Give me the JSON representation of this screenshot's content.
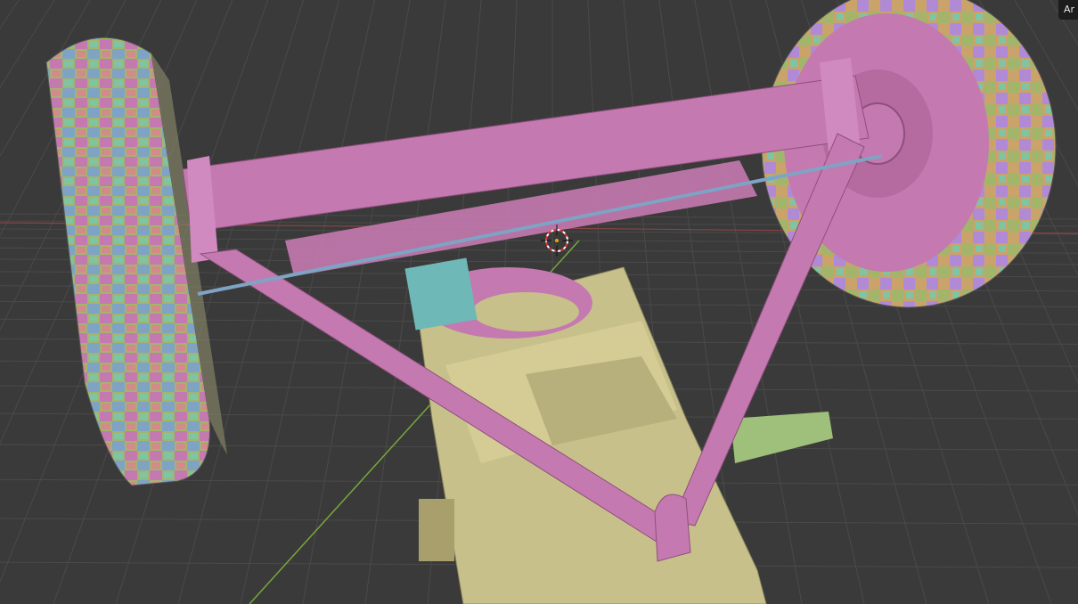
{
  "viewport": {
    "overlay_label": "Ar",
    "background_color": "#3a3a3a",
    "grid_color": "#4a4a4a",
    "y_axis_color": "#7aa63a",
    "x_axis_color": "#8a4444"
  },
  "model": {
    "face_set_colors": [
      "#c47ab0",
      "#a3b56a",
      "#7fa3c4",
      "#c9a36a",
      "#b18ad6",
      "#7fc4a3",
      "#d28a8a"
    ],
    "frame_color": "#c47ab0",
    "body_color": "#c8c08a",
    "accent_color": "#6fb8b8"
  }
}
